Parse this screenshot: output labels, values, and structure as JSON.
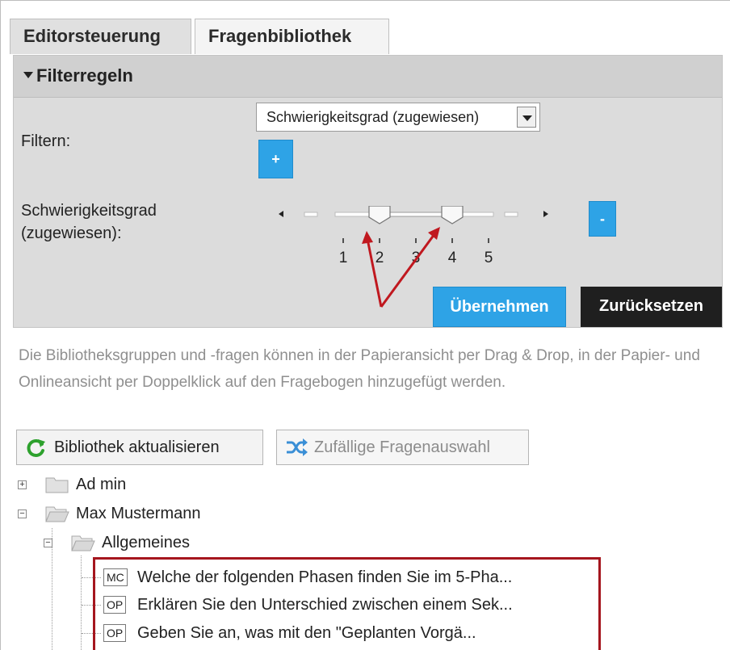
{
  "tabs": [
    {
      "label": "Editorsteuerung"
    },
    {
      "label": "Fragenbibliothek"
    }
  ],
  "filter": {
    "header": "Filterregeln",
    "filter_label": "Filtern:",
    "select_value": "Schwierigkeitsgrad (zugewiesen)",
    "add_label": "+",
    "difficulty_label_line1": "Schwierigkeitsgrad",
    "difficulty_label_line2": "(zugewiesen):",
    "remove_label": "-",
    "apply_label": "Übernehmen",
    "reset_label": "Zurücksetzen"
  },
  "slider": {
    "ticks": [
      "1",
      "2",
      "3",
      "4",
      "5"
    ],
    "range_min": 2,
    "range_max": 4
  },
  "info": {
    "text": "Die Bibliotheksgruppen und -fragen können in der Papieransicht per Drag & Drop, in der Papier- und Onlineansicht per Doppelklick auf den Fragebogen hinzugefügt werden."
  },
  "actions": {
    "refresh_label": "Bibliothek aktualisieren",
    "random_label": "Zufällige Fragenauswahl"
  },
  "tree": {
    "nodes": [
      {
        "label": "Ad min",
        "expander": "+"
      },
      {
        "label": "Max Mustermann",
        "expander": "−"
      },
      {
        "label": "Allgemeines",
        "expander": "−"
      }
    ],
    "questions": [
      {
        "type": "MC",
        "text": "Welche der folgenden Phasen finden Sie im 5-Pha..."
      },
      {
        "type": "OP",
        "text": "Erklären Sie den Unterschied zwischen einem Sek..."
      },
      {
        "type": "OP",
        "text": "Geben Sie an, was mit den \"Geplanten Vorgä..."
      }
    ]
  },
  "colors": {
    "accent_blue": "#2ea3e6",
    "reset_dark": "#1f1f1f",
    "annotation_red": "#c0181f"
  }
}
